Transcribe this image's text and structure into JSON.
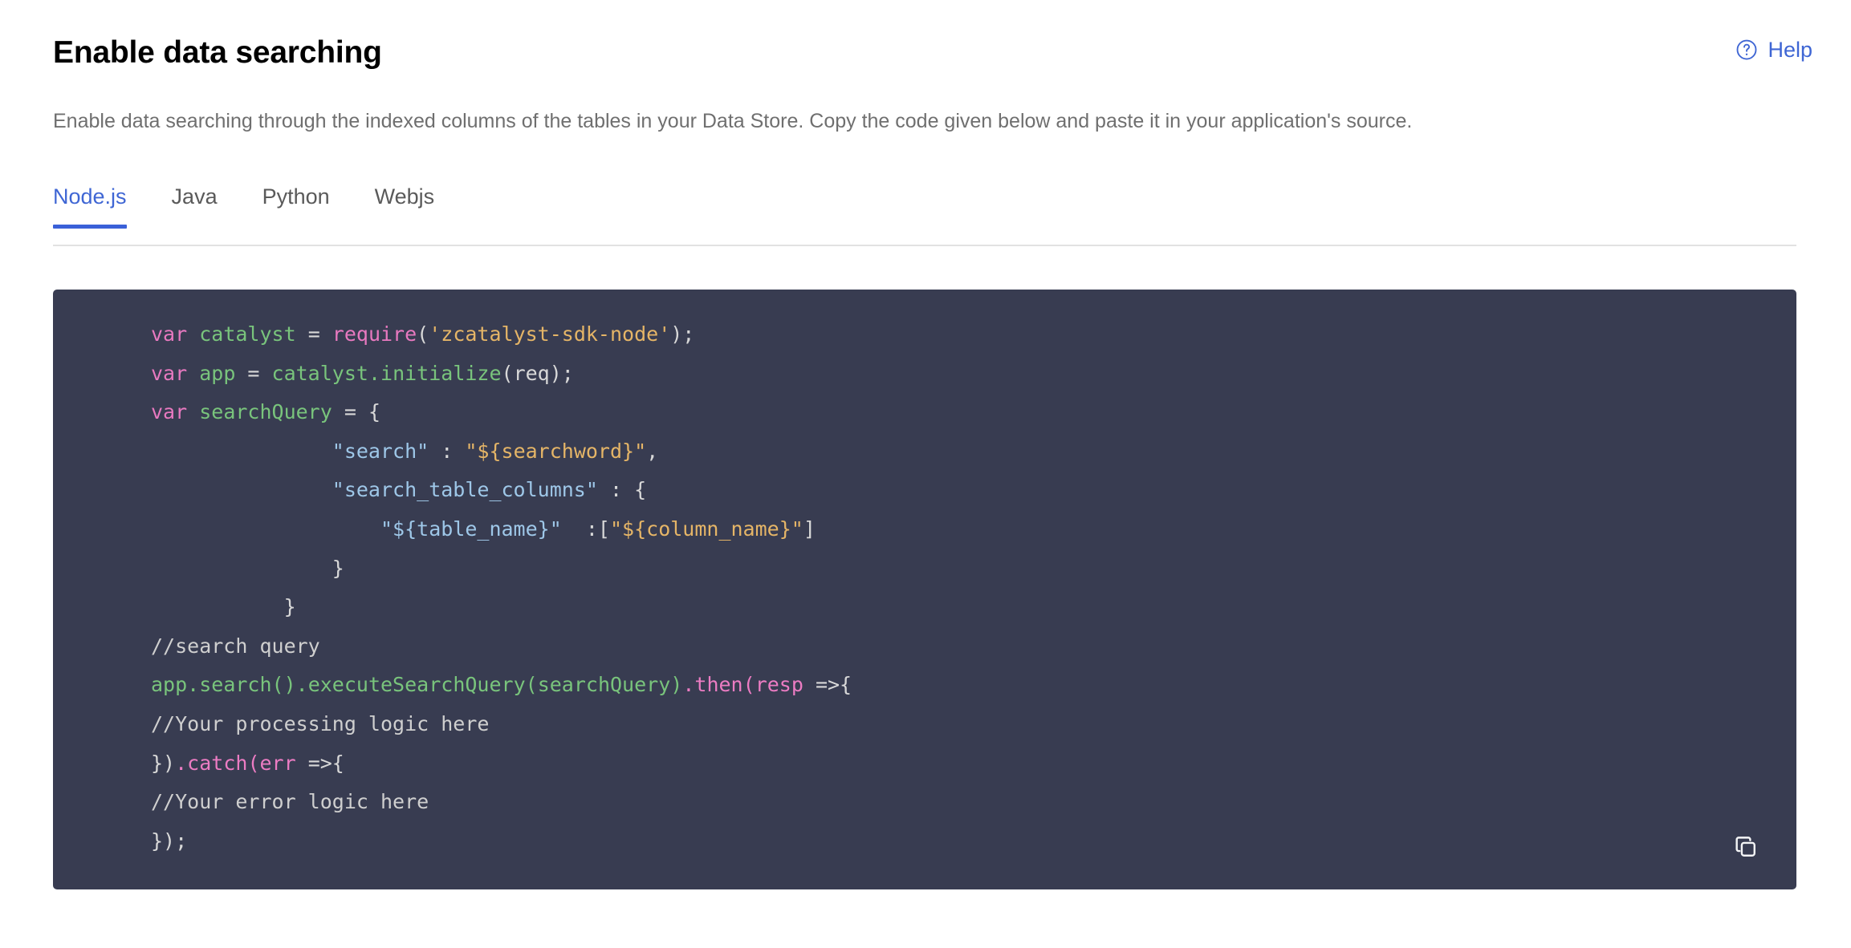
{
  "header": {
    "title": "Enable data searching",
    "help_label": "Help",
    "help_icon": "question-circle-icon",
    "accent_color": "#3f66d4"
  },
  "subtitle": "Enable data searching through the indexed columns of the tables in your Data Store. Copy the code given below and paste it in your application's source.",
  "tabs": {
    "active_index": 0,
    "items": [
      {
        "label": "Node.js"
      },
      {
        "label": "Java"
      },
      {
        "label": "Python"
      },
      {
        "label": "Webjs"
      }
    ],
    "active_underline_color": "#3a60d8"
  },
  "code_block": {
    "language": "Node.js",
    "background_color": "#383c51",
    "copy_icon": "copy-icon",
    "plain_text": "var catalyst = require('zcatalyst-sdk-node');\nvar app = catalyst.initialize(req);\nvar searchQuery = {\n               \"search\" : \"${searchword}\",\n               \"search_table_columns\" : {\n                   \"${table_name}\"  :[\"${column_name}\"]\n               }\n           }\n//search query\napp.search().executeSearchQuery(searchQuery).then(resp =>{\n//Your processing logic here\n}).catch(err =>{\n//Your error logic here\n});",
    "lines": [
      {
        "tokens": [
          {
            "t": "var",
            "c": "kw"
          },
          {
            "t": " ",
            "c": "pl"
          },
          {
            "t": "catalyst",
            "c": "id"
          },
          {
            "t": " = ",
            "c": "pl"
          },
          {
            "t": "require",
            "c": "fn"
          },
          {
            "t": "(",
            "c": "pl"
          },
          {
            "t": "'zcatalyst-sdk-node'",
            "c": "str"
          },
          {
            "t": ");",
            "c": "pl"
          }
        ]
      },
      {
        "tokens": [
          {
            "t": "var",
            "c": "kw"
          },
          {
            "t": " ",
            "c": "pl"
          },
          {
            "t": "app",
            "c": "id"
          },
          {
            "t": " = ",
            "c": "pl"
          },
          {
            "t": "catalyst",
            "c": "id"
          },
          {
            "t": ".",
            "c": "id"
          },
          {
            "t": "initialize",
            "c": "id"
          },
          {
            "t": "(req);",
            "c": "pl"
          }
        ]
      },
      {
        "tokens": [
          {
            "t": "var",
            "c": "kw"
          },
          {
            "t": " ",
            "c": "pl"
          },
          {
            "t": "searchQuery",
            "c": "id"
          },
          {
            "t": " = {",
            "c": "pl"
          }
        ]
      },
      {
        "tokens": [
          {
            "t": "               ",
            "c": "pl"
          },
          {
            "t": "\"search\"",
            "c": "key"
          },
          {
            "t": " : ",
            "c": "pl"
          },
          {
            "t": "\"${searchword}\"",
            "c": "str"
          },
          {
            "t": ",",
            "c": "pl"
          }
        ]
      },
      {
        "tokens": [
          {
            "t": "               ",
            "c": "pl"
          },
          {
            "t": "\"search_table_columns\"",
            "c": "key"
          },
          {
            "t": " : {",
            "c": "pl"
          }
        ]
      },
      {
        "tokens": [
          {
            "t": "                   ",
            "c": "pl"
          },
          {
            "t": "\"${table_name}\"",
            "c": "key"
          },
          {
            "t": "  :[",
            "c": "pl"
          },
          {
            "t": "\"${column_name}\"",
            "c": "str"
          },
          {
            "t": "]",
            "c": "pl"
          }
        ]
      },
      {
        "tokens": [
          {
            "t": "               }",
            "c": "pl"
          }
        ]
      },
      {
        "tokens": [
          {
            "t": "           }",
            "c": "pl"
          }
        ]
      },
      {
        "tokens": [
          {
            "t": "//search query",
            "c": "com"
          }
        ]
      },
      {
        "tokens": [
          {
            "t": "app",
            "c": "id"
          },
          {
            "t": ".",
            "c": "id"
          },
          {
            "t": "search",
            "c": "id"
          },
          {
            "t": "()",
            "c": "id"
          },
          {
            "t": ".",
            "c": "id"
          },
          {
            "t": "executeSearchQuery",
            "c": "id"
          },
          {
            "t": "(",
            "c": "id"
          },
          {
            "t": "searchQuery",
            "c": "id"
          },
          {
            "t": ")",
            "c": "id"
          },
          {
            "t": ".",
            "c": "prop"
          },
          {
            "t": "then",
            "c": "prop"
          },
          {
            "t": "(",
            "c": "prop"
          },
          {
            "t": "resp",
            "c": "prop"
          },
          {
            "t": " =>{",
            "c": "pl"
          }
        ]
      },
      {
        "tokens": [
          {
            "t": "//Your processing logic here",
            "c": "com"
          }
        ]
      },
      {
        "tokens": [
          {
            "t": "})",
            "c": "pl"
          },
          {
            "t": ".",
            "c": "prop"
          },
          {
            "t": "catch",
            "c": "prop"
          },
          {
            "t": "(",
            "c": "prop"
          },
          {
            "t": "err",
            "c": "prop"
          },
          {
            "t": " =>{",
            "c": "pl"
          }
        ]
      },
      {
        "tokens": [
          {
            "t": "//Your error logic here",
            "c": "com"
          }
        ]
      },
      {
        "tokens": [
          {
            "t": "});",
            "c": "pl"
          }
        ]
      }
    ]
  }
}
